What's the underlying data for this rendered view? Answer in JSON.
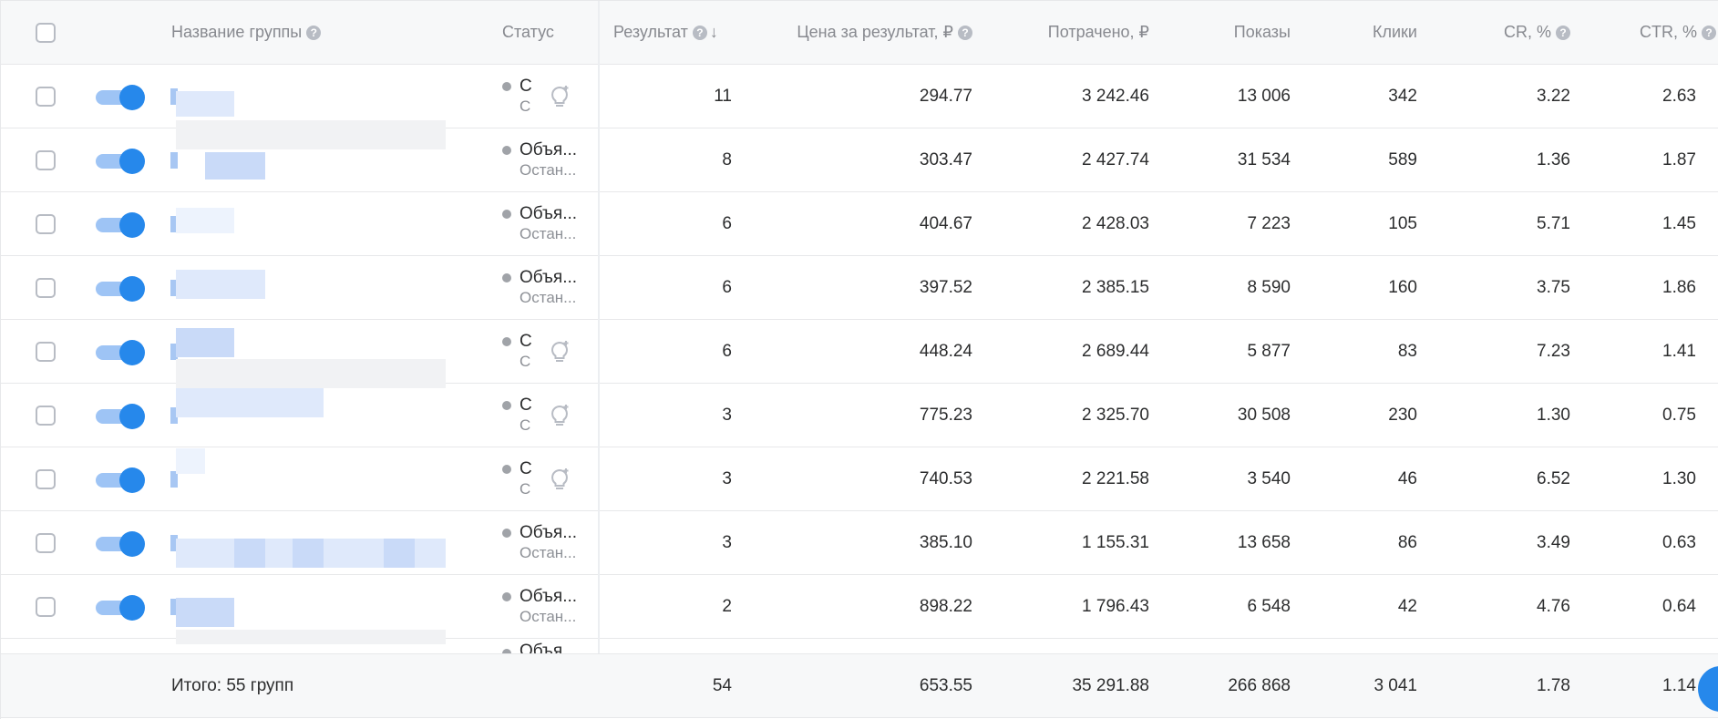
{
  "header": {
    "name": "Название группы",
    "status": "Статус",
    "result": "Результат",
    "sort_arrow": "↓",
    "price": "Цена за результат, ₽",
    "spent": "Потрачено, ₽",
    "impressions": "Показы",
    "clicks": "Клики",
    "cr": "CR, %",
    "ctr": "CTR, %",
    "help_icon": "?"
  },
  "rows": [
    {
      "status_main": "С",
      "status_sub": "С",
      "bulb": true,
      "result": "11",
      "price": "294.77",
      "spent": "3 242.46",
      "impressions": "13 006",
      "clicks": "342",
      "cr": "3.22",
      "ctr": "2.63"
    },
    {
      "status_main": "Объя...",
      "status_sub": "Остан...",
      "bulb": false,
      "result": "8",
      "price": "303.47",
      "spent": "2 427.74",
      "impressions": "31 534",
      "clicks": "589",
      "cr": "1.36",
      "ctr": "1.87"
    },
    {
      "status_main": "Объя...",
      "status_sub": "Остан...",
      "bulb": false,
      "result": "6",
      "price": "404.67",
      "spent": "2 428.03",
      "impressions": "7 223",
      "clicks": "105",
      "cr": "5.71",
      "ctr": "1.45"
    },
    {
      "status_main": "Объя...",
      "status_sub": "Остан...",
      "bulb": false,
      "result": "6",
      "price": "397.52",
      "spent": "2 385.15",
      "impressions": "8 590",
      "clicks": "160",
      "cr": "3.75",
      "ctr": "1.86"
    },
    {
      "status_main": "С",
      "status_sub": "С",
      "bulb": true,
      "result": "6",
      "price": "448.24",
      "spent": "2 689.44",
      "impressions": "5 877",
      "clicks": "83",
      "cr": "7.23",
      "ctr": "1.41"
    },
    {
      "status_main": "С",
      "status_sub": "С",
      "bulb": true,
      "result": "3",
      "price": "775.23",
      "spent": "2 325.70",
      "impressions": "30 508",
      "clicks": "230",
      "cr": "1.30",
      "ctr": "0.75"
    },
    {
      "status_main": "С",
      "status_sub": "С",
      "bulb": true,
      "result": "3",
      "price": "740.53",
      "spent": "2 221.58",
      "impressions": "3 540",
      "clicks": "46",
      "cr": "6.52",
      "ctr": "1.30"
    },
    {
      "status_main": "Объя...",
      "status_sub": "Остан...",
      "bulb": false,
      "result": "3",
      "price": "385.10",
      "spent": "1 155.31",
      "impressions": "13 658",
      "clicks": "86",
      "cr": "3.49",
      "ctr": "0.63"
    },
    {
      "status_main": "Объя...",
      "status_sub": "Остан...",
      "bulb": false,
      "result": "2",
      "price": "898.22",
      "spent": "1 796.43",
      "impressions": "6 548",
      "clicks": "42",
      "cr": "4.76",
      "ctr": "0.64"
    }
  ],
  "partial_row": {
    "status_main": "Объя..."
  },
  "footer": {
    "total_label": "Итого: 55 групп",
    "result": "54",
    "price": "653.55",
    "spent": "35 291.88",
    "impressions": "266 868",
    "clicks": "3 041",
    "cr": "1.78",
    "ctr": "1.14"
  },
  "colors": {
    "accent": "#2688eb",
    "header_bg": "#f7f8f9",
    "border": "#e7e8ea",
    "muted_text": "#87898f"
  },
  "icons": {
    "toggle": "toggle-switch",
    "help": "question-circle-icon",
    "bulb": "lightbulb-icon",
    "sort": "arrow-down-icon"
  }
}
